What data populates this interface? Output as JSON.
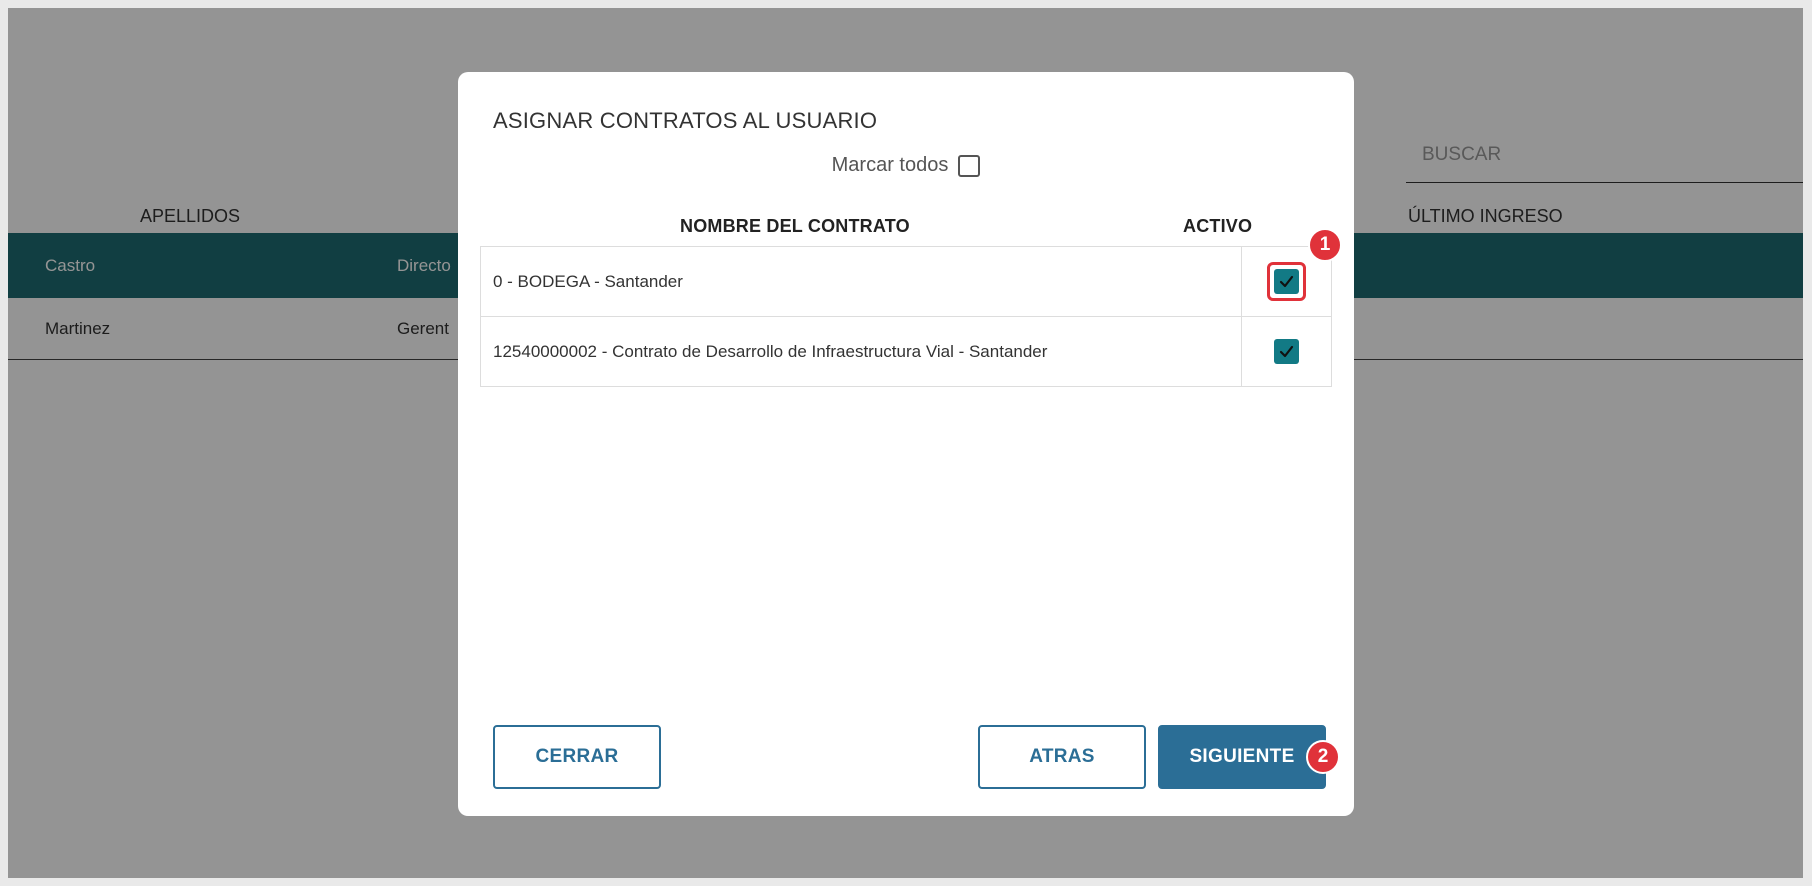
{
  "background": {
    "search_placeholder": "BUSCAR",
    "columns": {
      "apellidos": "APELLIDOS",
      "ultimo_ingreso": "ÚLTIMO INGRESO"
    },
    "rows": [
      {
        "apellido": "Castro",
        "cargo": "Directo"
      },
      {
        "apellido": "Martinez",
        "cargo": "Gerent"
      }
    ]
  },
  "modal": {
    "title": "ASIGNAR CONTRATOS AL USUARIO",
    "mark_all_label": "Marcar todos",
    "mark_all_checked": false,
    "columns": {
      "contract_name": "NOMBRE DEL CONTRATO",
      "active": "ACTIVO"
    },
    "contracts": [
      {
        "name": "0 - BODEGA - Santander",
        "active": true
      },
      {
        "name": "12540000002 - Contrato de Desarrollo de Infraestructura Vial - Santander",
        "active": true
      }
    ],
    "buttons": {
      "close": "CERRAR",
      "back": "ATRAS",
      "next": "SIGUIENTE"
    }
  },
  "annotations": {
    "marker_1": "1",
    "marker_2": "2"
  },
  "colors": {
    "teal_row": "#1e6c72",
    "checkbox_fill": "#127a85",
    "primary_button": "#2b6e96",
    "marker_red": "#e0323a"
  }
}
